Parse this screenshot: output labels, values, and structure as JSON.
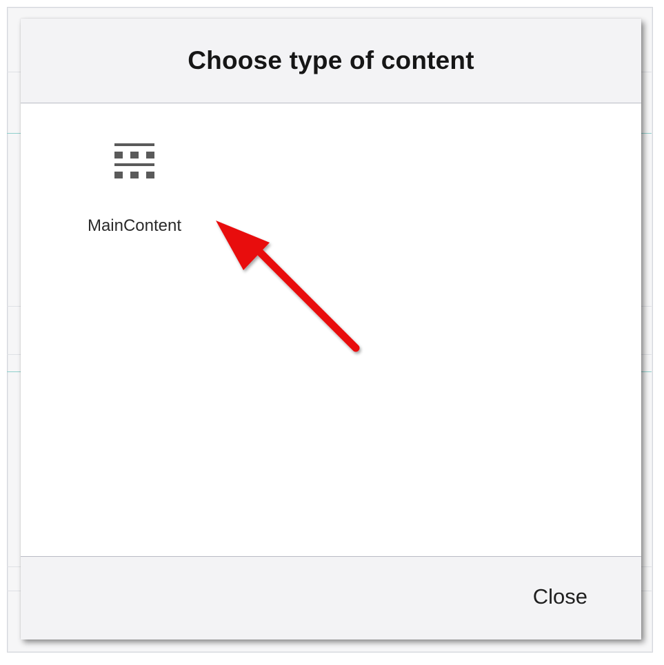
{
  "dialog": {
    "title": "Choose type of content",
    "content_types": [
      {
        "label": "MainContent",
        "icon": "main-content-grid-icon"
      }
    ],
    "close_label": "Close"
  },
  "colors": {
    "header_bg": "#f3f3f5",
    "footer_bg": "#f3f3f5",
    "icon": "#5a5a5a",
    "annotation_arrow": "#e8080d"
  }
}
